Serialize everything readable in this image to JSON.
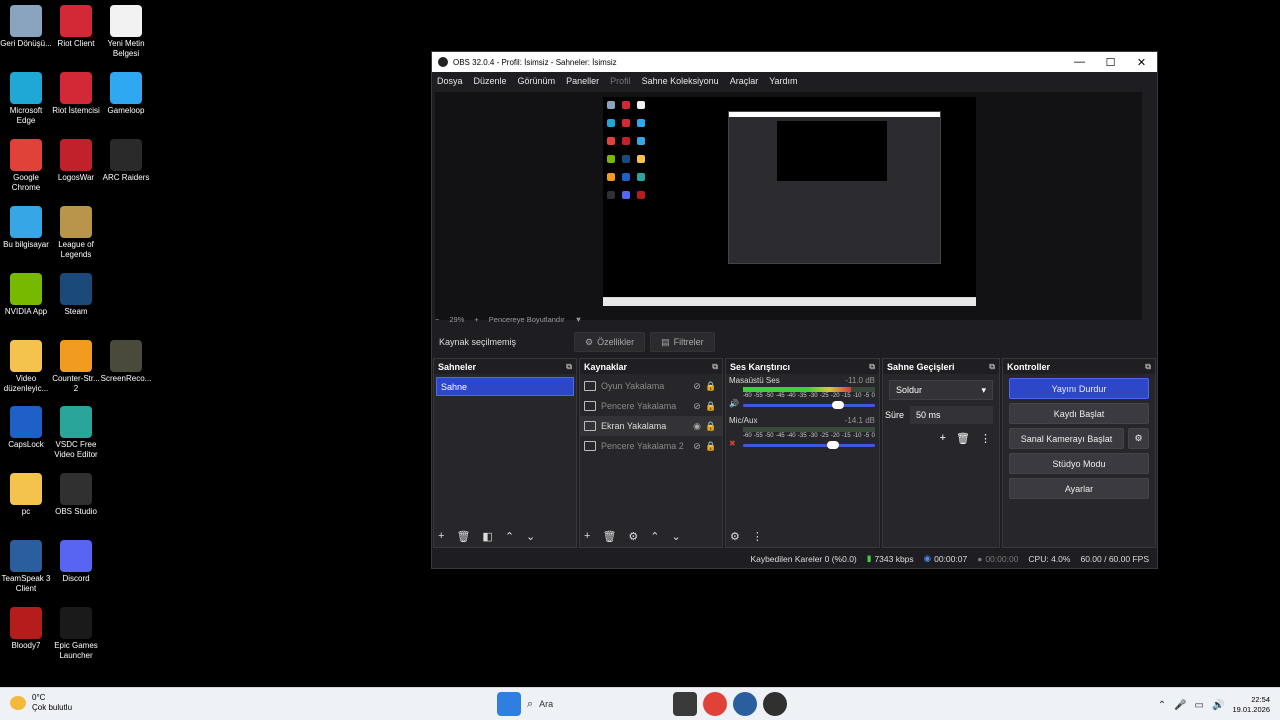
{
  "desktop": {
    "icons": [
      {
        "label": "Geri Dönüşü...",
        "icon": "recycle-bin-icon",
        "color": "#8aa4c0"
      },
      {
        "label": "Riot Client",
        "icon": "riot-client-icon",
        "color": "#d32936"
      },
      {
        "label": "Yeni Metin Belgesi",
        "icon": "text-document-icon",
        "color": "#f2f2f2"
      },
      {
        "label": "Microsoft Edge",
        "icon": "edge-icon",
        "color": "#1fa7d6"
      },
      {
        "label": "Riot İstemcisi",
        "icon": "riot-client-icon",
        "color": "#d32936"
      },
      {
        "label": "Gameloop",
        "icon": "gameloop-icon",
        "color": "#2ea8f0"
      },
      {
        "label": "Google Chrome",
        "icon": "chrome-icon",
        "color": "#e0423a"
      },
      {
        "label": "LogosWar",
        "icon": "logoswar-icon",
        "color": "#c0212b"
      },
      {
        "label": "ARC Raiders",
        "icon": "arc-raiders-icon",
        "color": "#2a2a2a"
      },
      {
        "label": "Bu bilgisayar",
        "icon": "computer-icon",
        "color": "#37a6e6"
      },
      {
        "label": "League of Legends",
        "icon": "league-of-legends-icon",
        "color": "#b8954a"
      },
      {
        "label": "NVIDIA App",
        "icon": "nvidia-icon",
        "color": "#76b900"
      },
      {
        "label": "Steam",
        "icon": "steam-icon",
        "color": "#1b4a7a"
      },
      {
        "label": "Video düzenleyic...",
        "icon": "folder-icon",
        "color": "#f3c34b"
      },
      {
        "label": "Counter-Str... 2",
        "icon": "counter-strike-icon",
        "color": "#f29c1f"
      },
      {
        "label": "ScreenReco...",
        "icon": "screen-recorder-icon",
        "color": "#4a4a3a"
      },
      {
        "label": "CapsLock",
        "icon": "capslock-icon",
        "color": "#1e60c8"
      },
      {
        "label": "VSDC Free Video Editor",
        "icon": "vsdc-icon",
        "color": "#2aa59a"
      },
      {
        "label": "pc",
        "icon": "folder-icon",
        "color": "#f3c34b"
      },
      {
        "label": "OBS Studio",
        "icon": "obs-icon",
        "color": "#303030"
      },
      {
        "label": "TeamSpeak 3 Client",
        "icon": "teamspeak-icon",
        "color": "#2b5e9c"
      },
      {
        "label": "Discord",
        "icon": "discord-icon",
        "color": "#5865f2"
      },
      {
        "label": "Bloody7",
        "icon": "bloody-icon",
        "color": "#b51d1d"
      },
      {
        "label": "Epic Games Launcher",
        "icon": "epic-games-icon",
        "color": "#1a1a1a"
      }
    ]
  },
  "obs": {
    "title": "OBS 32.0.4 - Profil: İsimsiz - Sahneler: İsimsiz",
    "menu": [
      "Dosya",
      "Düzenle",
      "Görünüm",
      "Paneller",
      "Profil",
      "Sahne Koleksiyonu",
      "Araçlar",
      "Yardım"
    ],
    "zoom": {
      "minus": "−",
      "value": "29%",
      "plus": "+",
      "mode": "Pencereye Boyutlandır"
    },
    "no_source": "Kaynak seçilmemiş",
    "properties_label": "Özellikler",
    "filters_label": "Filtreler",
    "scenes": {
      "title": "Sahneler",
      "items": [
        "Sahne"
      ]
    },
    "sources": {
      "title": "Kaynaklar",
      "items": [
        {
          "name": "Oyun Yakalama",
          "active": false,
          "icon": "gamepad-icon"
        },
        {
          "name": "Pencere Yakalama",
          "active": false,
          "icon": "window-icon"
        },
        {
          "name": "Ekran Yakalama",
          "active": true,
          "icon": "monitor-icon"
        },
        {
          "name": "Pencere Yakalama 2",
          "active": false,
          "icon": "window-icon"
        }
      ]
    },
    "mixer": {
      "title": "Ses Karıştırıcı",
      "channels": [
        {
          "name": "Masaüstü Ses",
          "db": "-11.0 dB",
          "level": 0.82,
          "volume": 0.72,
          "muted": false
        },
        {
          "name": "Mic/Aux",
          "db": "-14.1 dB",
          "level": 0.0,
          "volume": 0.68,
          "muted": true
        }
      ],
      "scale": [
        "-60",
        "-55",
        "-50",
        "-45",
        "-40",
        "-35",
        "-30",
        "-25",
        "-20",
        "-15",
        "-10",
        "-5",
        "0"
      ]
    },
    "transitions": {
      "title": "Sahne Geçişleri",
      "selected": "Soldur",
      "duration_label": "Süre",
      "duration": "50 ms"
    },
    "controls": {
      "title": "Kontroller",
      "buttons": [
        "Yayını Durdur",
        "Kaydı Başlat",
        "Sanal Kamerayı Başlat",
        "Stüdyo Modu",
        "Ayarlar"
      ]
    },
    "status": {
      "dropped": "Kaybedilen Kareler 0 (%0.0)",
      "bitrate": "7343 kbps",
      "stream_time": "00:00:07",
      "record_time": "00:00:00",
      "cpu": "CPU: 4.0%",
      "fps": "60.00 / 60.00 FPS"
    },
    "colors": {
      "accent": "#2c48c8",
      "meter_green": "#3fcf3f",
      "meter_yellow": "#d6c83b",
      "meter_red": "#d93b3b"
    }
  },
  "taskbar": {
    "weather_temp": "0°C",
    "weather_desc": "Çok bulutlu",
    "search_placeholder": "Ara",
    "time": "22:54",
    "date": "19.01.2026"
  }
}
